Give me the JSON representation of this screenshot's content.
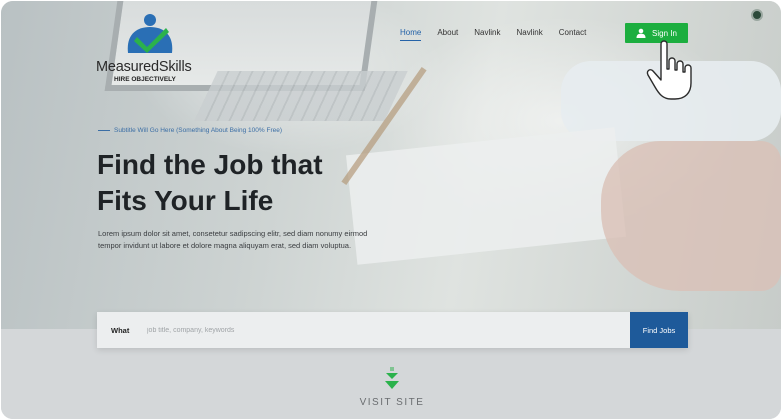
{
  "brand": {
    "name": "MeasuredSkills",
    "tagline": "HIRE OBJECTIVELY"
  },
  "nav": {
    "links": [
      {
        "label": "Home",
        "active": true
      },
      {
        "label": "About",
        "active": false
      },
      {
        "label": "Navlink",
        "active": false
      },
      {
        "label": "Navlink",
        "active": false
      },
      {
        "label": "Contact",
        "active": false
      }
    ],
    "signin_label": "Sign In"
  },
  "hero": {
    "subtitle": "Subtitle Will Go Here (Something About Being 100% Free)",
    "headline_line1": "Find the Job that",
    "headline_line2": "Fits Your Life",
    "body": "Lorem ipsum dolor sit amet, consetetur sadipscing elitr, sed diam nonumy eirmod tempor invidunt ut labore et dolore magna aliquyam erat, sed diam voluptua."
  },
  "search": {
    "label": "What",
    "placeholder": "job title, company, keywords",
    "button_label": "Find Jobs"
  },
  "footer": {
    "visit_label": "VISIT SITE"
  },
  "colors": {
    "accent_blue": "#1e5a9a",
    "signin_green": "#1cae3f",
    "nav_active": "#2563a8"
  },
  "icons": [
    "logo-mark-icon",
    "user-icon",
    "hand-cursor-icon",
    "visit-arrow-icon"
  ]
}
